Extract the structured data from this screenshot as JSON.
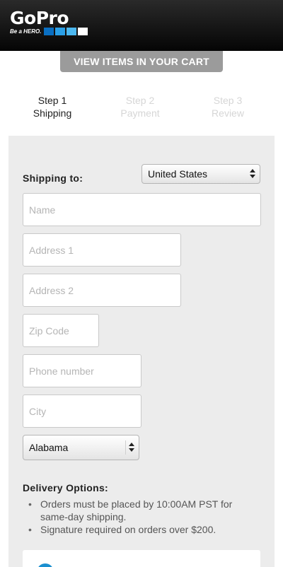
{
  "header": {
    "logo_text": "GoPro",
    "tagline": "Be a HERO.",
    "logo_colors": [
      "#0a6fc2",
      "#2aa0e8",
      "#4cb8f0",
      "#ffffff"
    ]
  },
  "cart_button": {
    "label": "VIEW ITEMS IN YOUR CART"
  },
  "steps": [
    {
      "line1": "Step 1",
      "line2": "Shipping",
      "active": true
    },
    {
      "line1": "Step 2",
      "line2": "Payment",
      "active": false
    },
    {
      "line1": "Step 3",
      "line2": "Review",
      "active": false
    }
  ],
  "shipping": {
    "label": "Shipping to:",
    "country": "United States",
    "fields": {
      "name": "Name",
      "address1": "Address 1",
      "address2": "Address 2",
      "zip": "Zip Code",
      "phone": "Phone number",
      "city": "City"
    },
    "state": "Alabama"
  },
  "delivery": {
    "title": "Delivery Options:",
    "items": [
      "Orders must be placed by 10:00AM PST for same-day shipping.",
      "Signature required on orders over $200."
    ]
  },
  "colors": {
    "header_bg": "#000000",
    "panel_bg": "#ececec",
    "button_bg": "#9b9b9b",
    "accent_blue": "#1a8fd0"
  }
}
